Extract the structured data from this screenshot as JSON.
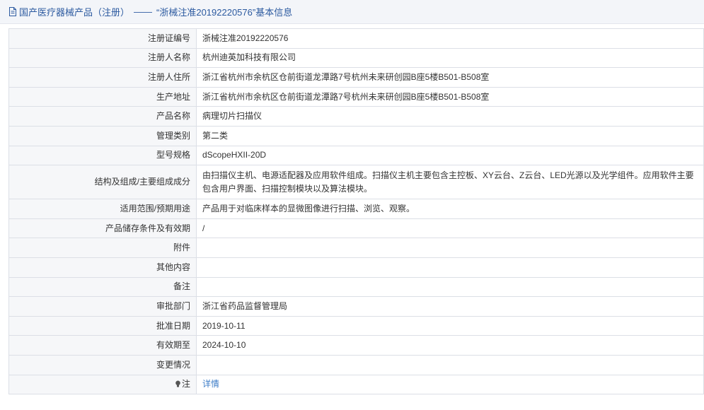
{
  "header": {
    "icon": "document-icon",
    "category": "国产医疗器械产品（注册）",
    "separator": "——",
    "title": "“浙械注准20192220576”基本信息",
    "color": "#2c5aa0"
  },
  "rows": [
    {
      "label": "注册证编号",
      "value": "浙械注准20192220576"
    },
    {
      "label": "注册人名称",
      "value": "杭州迪英加科技有限公司"
    },
    {
      "label": "注册人住所",
      "value": "浙江省杭州市余杭区仓前街道龙潭路7号杭州未来研创园B座5楼B501-B508室"
    },
    {
      "label": "生产地址",
      "value": "浙江省杭州市余杭区仓前街道龙潭路7号杭州未来研创园B座5楼B501-B508室"
    },
    {
      "label": "产品名称",
      "value": "病理切片扫描仪"
    },
    {
      "label": "管理类别",
      "value": "第二类"
    },
    {
      "label": "型号规格",
      "value": "dScopeHXII-20D"
    },
    {
      "label": "结构及组成/主要组成成分",
      "value": "由扫描仪主机、电源适配器及应用软件组成。扫描仪主机主要包含主控板、XY云台、Z云台、LED光源以及光学组件。应用软件主要包含用户界面、扫描控制模块以及算法模块。"
    },
    {
      "label": "适用范围/预期用途",
      "value": "产品用于对临床样本的显微图像进行扫描、浏览、观察。"
    },
    {
      "label": "产品储存条件及有效期",
      "value": "/"
    },
    {
      "label": "附件",
      "value": ""
    },
    {
      "label": "其他内容",
      "value": ""
    },
    {
      "label": "备注",
      "value": ""
    },
    {
      "label": "审批部门",
      "value": "浙江省药品监督管理局"
    },
    {
      "label": "批准日期",
      "value": "2019-10-11"
    },
    {
      "label": "有效期至",
      "value": "2024-10-10"
    },
    {
      "label": "变更情况",
      "value": ""
    }
  ],
  "note_row": {
    "icon": "lightbulb-icon",
    "label": "注",
    "link_text": "详情",
    "link_color": "#3c7cc7"
  }
}
